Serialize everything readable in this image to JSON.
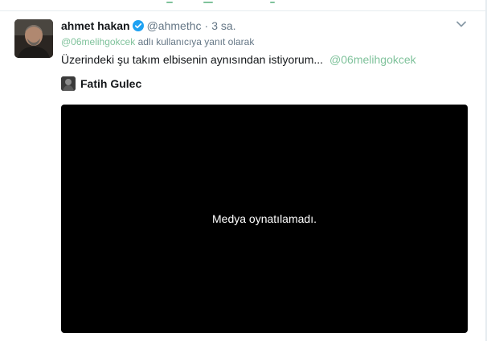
{
  "tweet": {
    "author": {
      "name": "ahmet hakan",
      "handle": "@ahmethc",
      "verified": true,
      "avatar_icon": "user-avatar-photo"
    },
    "separator": "·",
    "time": "3 sa.",
    "reply_to": {
      "mention": "@06melihgokcek",
      "suffix": " adlı kullanıcıya yanıt olarak"
    },
    "text": "Üzerindeki şu takım elbisenin aynısından istiyorum...",
    "text_mention": "@06melihgokcek",
    "media_attribution": {
      "name": "Fatih Gulec",
      "avatar_icon": "user-avatar-photo"
    },
    "media": {
      "error_message": "Medya oynatılamadı."
    }
  },
  "colors": {
    "accent": "#7fc29b",
    "verified": "#1da1f2",
    "secondary_text": "#657786"
  }
}
